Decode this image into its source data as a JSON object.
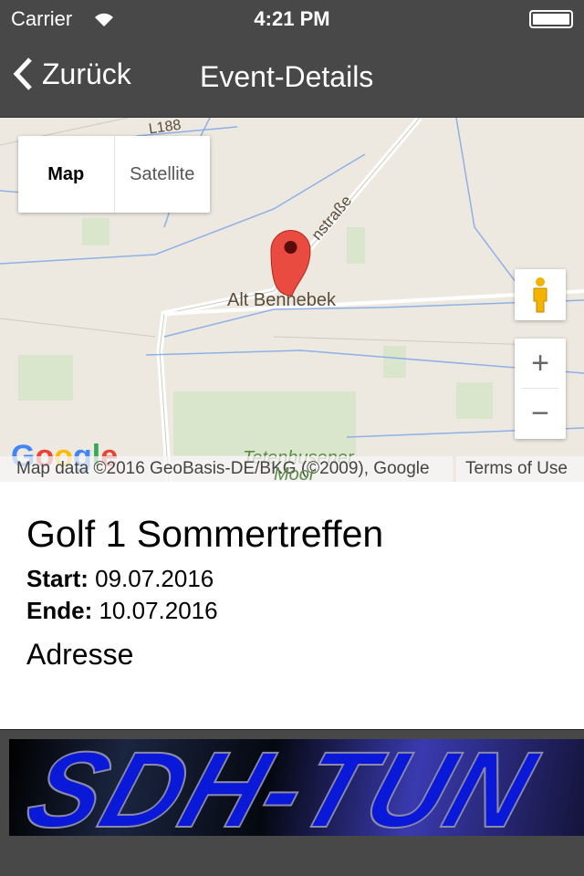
{
  "status_bar": {
    "carrier": "Carrier",
    "time": "4:21 PM"
  },
  "nav": {
    "back_label": "Zurück",
    "title": "Event-Details"
  },
  "map": {
    "type_control": {
      "map": "Map",
      "satellite": "Satellite",
      "selected": "Map"
    },
    "labels": {
      "place": "Alt Bennebek",
      "road": "L188",
      "street": "nstraße",
      "area_1": "Tetenhusener",
      "area_2": "Moor"
    },
    "zoom_in": "+",
    "zoom_out": "−",
    "attribution": "Map data ©2016 GeoBasis-DE/BKG (©2009), Google",
    "terms": "Terms of Use",
    "logo": "Google"
  },
  "event": {
    "title": "Golf 1 Sommertreffen",
    "start_label": "Start:",
    "start": "09.07.2016",
    "end_label": "Ende:",
    "end": "10.07.2016",
    "address_heading": "Adresse"
  },
  "banner": {
    "text": "SDH-TUN"
  }
}
